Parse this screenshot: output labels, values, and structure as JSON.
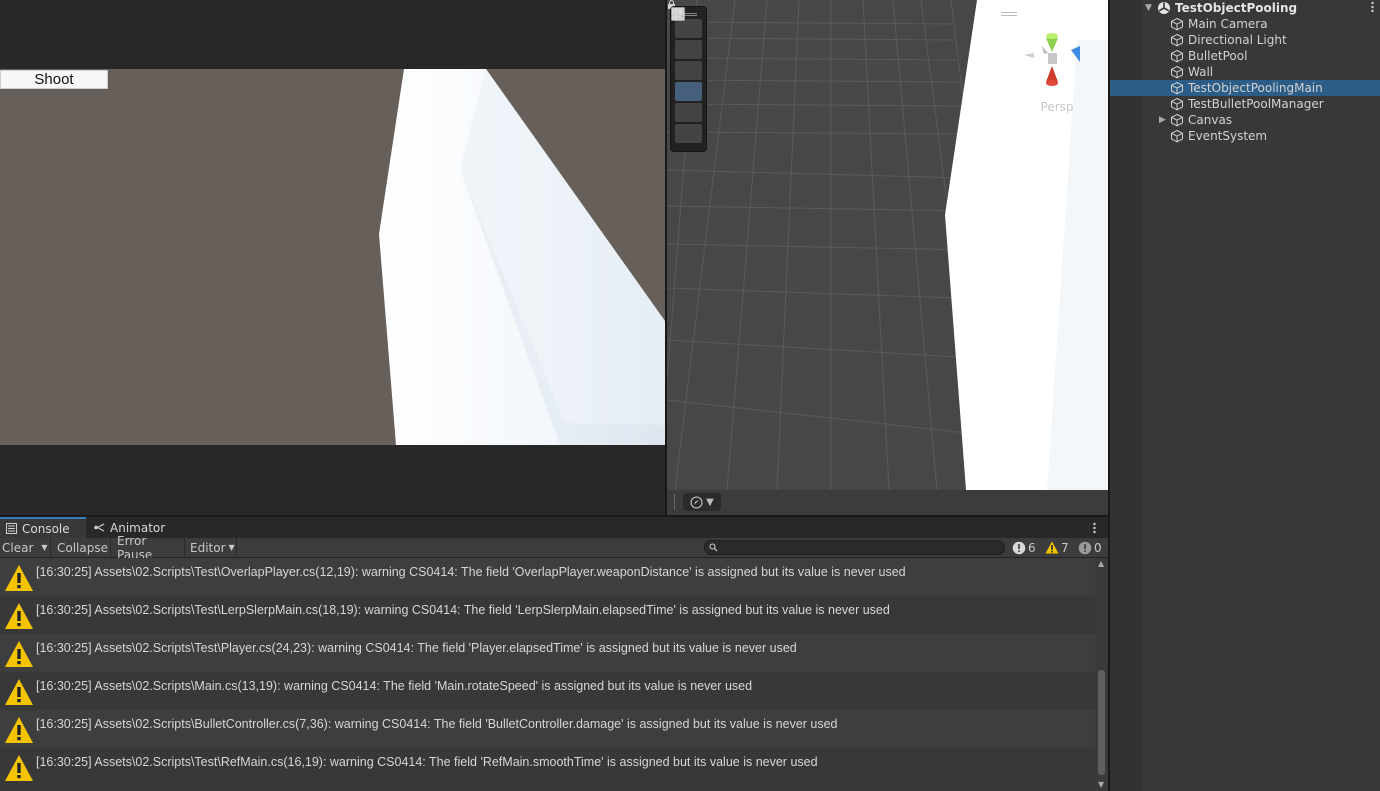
{
  "game_view": {
    "shoot_label": "Shoot"
  },
  "scene_view": {
    "projection_label": "Persp",
    "tools": [
      {
        "icon": "hand-tool-icon",
        "active": false
      },
      {
        "icon": "move-tool-icon",
        "active": false
      },
      {
        "icon": "rotate-tool-icon",
        "active": false
      },
      {
        "icon": "scale-tool-icon",
        "active": true
      },
      {
        "icon": "rect-tool-icon",
        "active": false
      },
      {
        "icon": "transform-tool-icon",
        "active": false
      }
    ]
  },
  "hierarchy": {
    "scene_name": "TestObjectPooling",
    "items": [
      {
        "label": "Main Camera",
        "selected": false,
        "expandable": false
      },
      {
        "label": "Directional Light",
        "selected": false,
        "expandable": false
      },
      {
        "label": "BulletPool",
        "selected": false,
        "expandable": false
      },
      {
        "label": "Wall",
        "selected": false,
        "expandable": false
      },
      {
        "label": "TestObjectPoolingMain",
        "selected": true,
        "expandable": false
      },
      {
        "label": "TestBulletPoolManager",
        "selected": false,
        "expandable": false
      },
      {
        "label": "Canvas",
        "selected": false,
        "expandable": true
      },
      {
        "label": "EventSystem",
        "selected": false,
        "expandable": false
      }
    ],
    "selected_color": "#2c5d87"
  },
  "console": {
    "tabs": [
      {
        "label": "Console",
        "icon": "console-icon",
        "active": true
      },
      {
        "label": "Animator",
        "icon": "animator-icon",
        "active": false
      }
    ],
    "toolbar": {
      "clear_label": "Clear",
      "collapse_label": "Collapse",
      "error_pause_label": "Error Pause",
      "editor_label": "Editor",
      "search_placeholder": ""
    },
    "counts": {
      "info": "6",
      "warnings": "7",
      "errors": "0"
    },
    "messages": [
      {
        "type": "warning",
        "text": "[16:30:25] Assets\\02.Scripts\\Test\\OverlapPlayer.cs(12,19): warning CS0414: The field 'OverlapPlayer.weaponDistance' is assigned but its value is never used"
      },
      {
        "type": "warning",
        "text": "[16:30:25] Assets\\02.Scripts\\Test\\LerpSlerpMain.cs(18,19): warning CS0414: The field 'LerpSlerpMain.elapsedTime' is assigned but its value is never used"
      },
      {
        "type": "warning",
        "text": "[16:30:25] Assets\\02.Scripts\\Test\\Player.cs(24,23): warning CS0414: The field 'Player.elapsedTime' is assigned but its value is never used"
      },
      {
        "type": "warning",
        "text": "[16:30:25] Assets\\02.Scripts\\Main.cs(13,19): warning CS0414: The field 'Main.rotateSpeed' is assigned but its value is never used"
      },
      {
        "type": "warning",
        "text": "[16:30:25] Assets\\02.Scripts\\BulletController.cs(7,36): warning CS0414: The field 'BulletController.damage' is assigned but its value is never used"
      },
      {
        "type": "warning",
        "text": "[16:30:25] Assets\\02.Scripts\\Test\\RefMain.cs(16,19): warning CS0414: The field 'RefMain.smoothTime' is assigned but its value is never used"
      }
    ],
    "warning_color": "#f4c400"
  }
}
